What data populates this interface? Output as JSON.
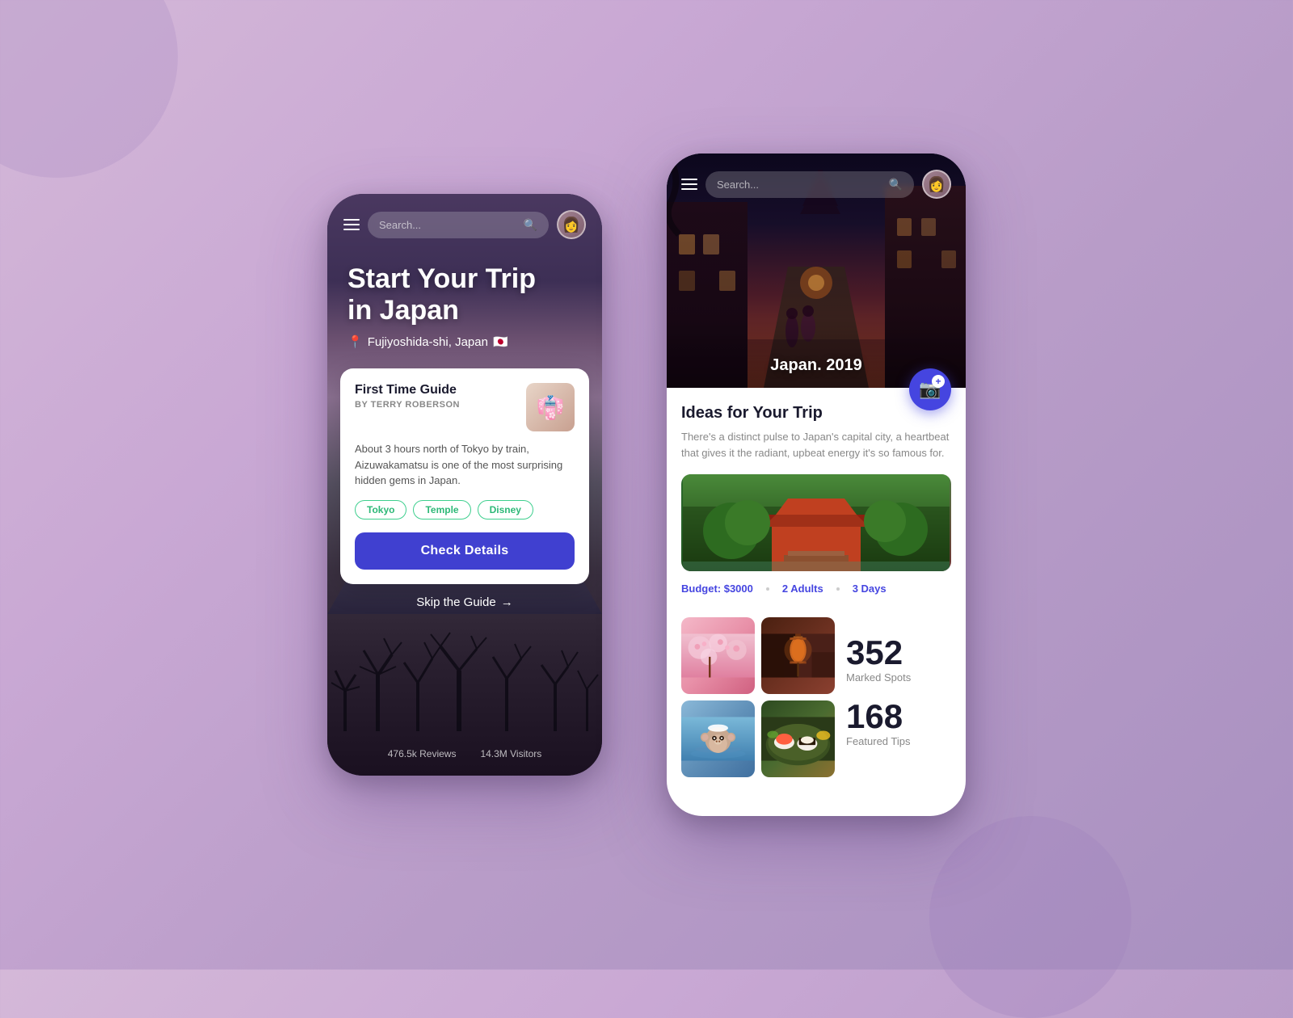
{
  "background": {
    "gradient": "linear-gradient(135deg, #d4b8d8, #b89cc8)"
  },
  "phone1": {
    "header": {
      "search_placeholder": "Search...",
      "avatar_emoji": "👩"
    },
    "title": "Start Your Trip\nin Japan",
    "location": "Fujiyoshida-shi, Japan",
    "flag": "🇯🇵",
    "guide_card": {
      "title": "First Time Guide",
      "author_prefix": "BY",
      "author": "TERRY ROBERSON",
      "description": "About 3 hours north of Tokyo by train, Aizuwakamatsu is one of the most surprising hidden gems in Japan.",
      "thumbnail_emoji": "👘",
      "tags": [
        "Tokyo",
        "Temple",
        "Disney"
      ],
      "check_details_label": "Check Details",
      "skip_guide_label": "Skip the Guide",
      "skip_arrow": "→"
    },
    "footer": {
      "reviews": "476.5k Reviews",
      "visitors": "14.3M Visitors"
    }
  },
  "phone2": {
    "header": {
      "search_placeholder": "Search...",
      "avatar_emoji": "👩"
    },
    "hero_label": "Japan. 2019",
    "camera_plus": "+",
    "content": {
      "ideas_title": "Ideas for Your Trip",
      "ideas_desc": "There's a distinct pulse to Japan's capital city, a heartbeat that gives it the radiant, upbeat energy it's so famous for.",
      "trip_photo_emoji": "🏯",
      "budget": "Budget: $3000",
      "adults": "2 Adults",
      "days": "3 Days",
      "stats": [
        {
          "number": "352",
          "label": "Marked Spots"
        },
        {
          "number": "168",
          "label": "Featured Tips"
        }
      ]
    }
  }
}
